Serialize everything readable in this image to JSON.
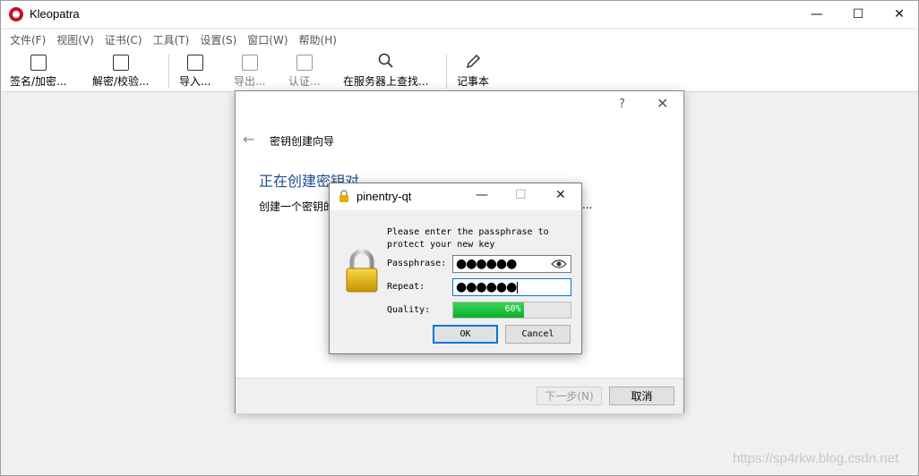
{
  "window": {
    "title": "Kleopatra"
  },
  "menu": [
    "文件(F)",
    "视图(V)",
    "证书(C)",
    "工具(T)",
    "设置(S)",
    "窗口(W)",
    "帮助(H)"
  ],
  "toolbar": {
    "sign_encrypt": "签名/加密...",
    "decrypt_verify": "解密/校验...",
    "import": "导入...",
    "export": "导出...",
    "certify": "认证...",
    "lookup_server": "在服务器上查找...",
    "notepad": "记事本"
  },
  "wizard": {
    "help": "?",
    "title": "密钥创建向导",
    "heading": "正在创建密钥对...",
    "text": "创建一个密钥的",
    "text_tail": "...",
    "next_button": "下一步(N)",
    "cancel_button": "取消"
  },
  "pinentry": {
    "title": "pinentry-qt",
    "prompt": "Please enter the passphrase to\nprotect your new key",
    "passphrase_label": "Passphrase:",
    "passphrase_value": "●●●●●●",
    "repeat_label": "Repeat:",
    "repeat_value": "●●●●●●",
    "quality_label": "Quality:",
    "quality_value": "60%",
    "quality_fraction": 0.6,
    "ok_button": "OK",
    "cancel_button": "Cancel"
  },
  "watermark": "https://sp4rkw.blog.csdn.net"
}
